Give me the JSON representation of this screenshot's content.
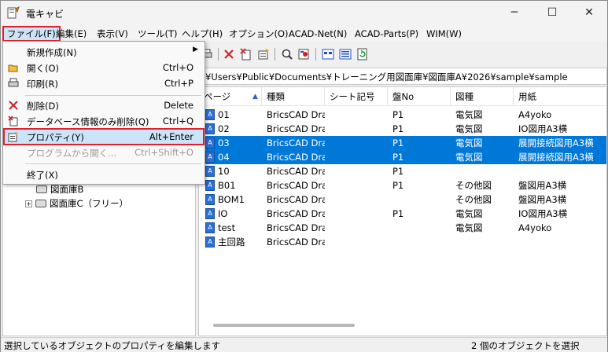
{
  "window": {
    "title": "電キャビ",
    "min_glyph": "─",
    "max_glyph": "☐",
    "close_glyph": "✕"
  },
  "menubar": [
    {
      "label": "ファイル(F)"
    },
    {
      "label": "編集(E)"
    },
    {
      "label": "表示(V)"
    },
    {
      "label": "ツール(T)"
    },
    {
      "label": "ヘルプ(H)"
    },
    {
      "label": "オプション(O)"
    },
    {
      "label": "ACAD-Net(N)"
    },
    {
      "label": "ACAD-Parts(P)"
    },
    {
      "label": "WIM(W)"
    }
  ],
  "file_menu": {
    "new": {
      "label": "新規作成(N)",
      "icon": "submenu-arrow"
    },
    "open": {
      "label": "開く(O)",
      "shortcut": "Ctrl+O",
      "icon": "folder-open-icon"
    },
    "print": {
      "label": "印刷(R)",
      "shortcut": "Ctrl+P",
      "icon": "printer-icon"
    },
    "delete": {
      "label": "削除(D)",
      "shortcut": "Delete",
      "icon": "delete-x-icon"
    },
    "delete_db": {
      "label": "データベース情報のみ削除(Q)",
      "shortcut": "Ctrl+Q",
      "icon": "delete-db-icon"
    },
    "properties": {
      "label": "プロパティ(Y)",
      "shortcut": "Alt+Enter",
      "icon": "properties-icon"
    },
    "open_program": {
      "label": "プログラムから開く...",
      "shortcut": "Ctrl+Shift+O"
    },
    "exit": {
      "label": "終了(X)"
    }
  },
  "path": "¥Users¥Public¥Documents¥トレーニング用図面庫¥図面庫A¥2026¥sample¥sample",
  "tree": [
    {
      "label": "図面庫B"
    },
    {
      "label": "図面庫C（フリー）"
    }
  ],
  "columns": {
    "page": "ページ",
    "type": "種類",
    "sheet": "シート記号",
    "panel": "盤No",
    "kind": "図種",
    "paper": "用紙"
  },
  "rows": [
    {
      "page": "01",
      "type": "BricsCAD Drav",
      "sheet": "",
      "panel": "P1",
      "kind": "電気図",
      "paper": "A4yoko",
      "selected": false
    },
    {
      "page": "02",
      "type": "BricsCAD Drav",
      "sheet": "",
      "panel": "P1",
      "kind": "電気図",
      "paper": "IO図用A3横",
      "selected": false
    },
    {
      "page": "03",
      "type": "BricsCAD Drav",
      "sheet": "",
      "panel": "P1",
      "kind": "電気図",
      "paper": "展開接続図用A3横",
      "selected": true
    },
    {
      "page": "04",
      "type": "BricsCAD Drav",
      "sheet": "",
      "panel": "P1",
      "kind": "電気図",
      "paper": "展開接続図用A3横",
      "selected": true
    },
    {
      "page": "10",
      "type": "BricsCAD Drav",
      "sheet": "",
      "panel": "P1",
      "kind": "",
      "paper": "",
      "selected": false
    },
    {
      "page": "B01",
      "type": "BricsCAD Drav",
      "sheet": "",
      "panel": "P1",
      "kind": "その他図",
      "paper": "盤図用A3横",
      "selected": false
    },
    {
      "page": "BOM1",
      "type": "BricsCAD Drav",
      "sheet": "",
      "panel": "",
      "kind": "その他図",
      "paper": "盤図用A3横",
      "selected": false
    },
    {
      "page": "IO",
      "type": "BricsCAD Drav",
      "sheet": "",
      "panel": "P1",
      "kind": "電気図",
      "paper": "IO図用A3横",
      "selected": false
    },
    {
      "page": "test",
      "type": "BricsCAD Drav",
      "sheet": "",
      "panel": "",
      "kind": "電気図",
      "paper": "A4yoko",
      "selected": false
    },
    {
      "page": "主回路",
      "type": "BricsCAD Drav",
      "sheet": "",
      "panel": "",
      "kind": "",
      "paper": "",
      "selected": false
    }
  ],
  "status": {
    "left": "選択しているオブジェクトのプロパティを編集します",
    "right": "2 個のオブジェクトを選択"
  },
  "colors": {
    "selection": "#0078d7",
    "highlight_border": "#e0202a",
    "menu_hover": "#cce4f7"
  }
}
